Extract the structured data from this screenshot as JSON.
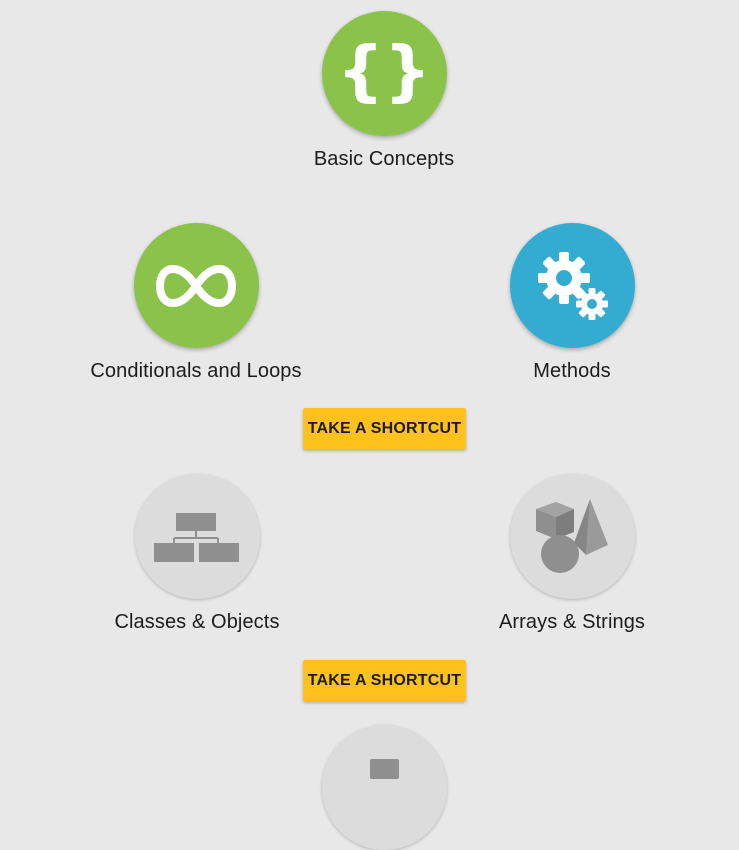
{
  "nodes": {
    "basic_concepts": {
      "label": "Basic Concepts",
      "icon": "curly-braces-icon",
      "status": "completed"
    },
    "conditionals_loops": {
      "label": "Conditionals and Loops",
      "icon": "infinity-icon",
      "status": "completed"
    },
    "methods": {
      "label": "Methods",
      "icon": "gears-icon",
      "status": "current"
    },
    "classes_objects": {
      "label": "Classes & Objects",
      "icon": "hierarchy-chart-icon",
      "status": "locked"
    },
    "arrays_strings": {
      "label": "Arrays & Strings",
      "icon": "shapes-icon",
      "status": "locked"
    },
    "next_module": {
      "icon": "module-icon",
      "status": "locked"
    }
  },
  "shortcuts": [
    {
      "label": "TAKE A SHORTCUT"
    },
    {
      "label": "TAKE A SHORTCUT"
    }
  ],
  "colors": {
    "background": "#e8e8e8",
    "completed": "#8bc34a",
    "current": "#34acd1",
    "locked": "#dcdcdc",
    "locked_icon": "#8f8f8f",
    "shortcut": "#ffc21c"
  },
  "glyphs": {
    "braces": "{}"
  }
}
